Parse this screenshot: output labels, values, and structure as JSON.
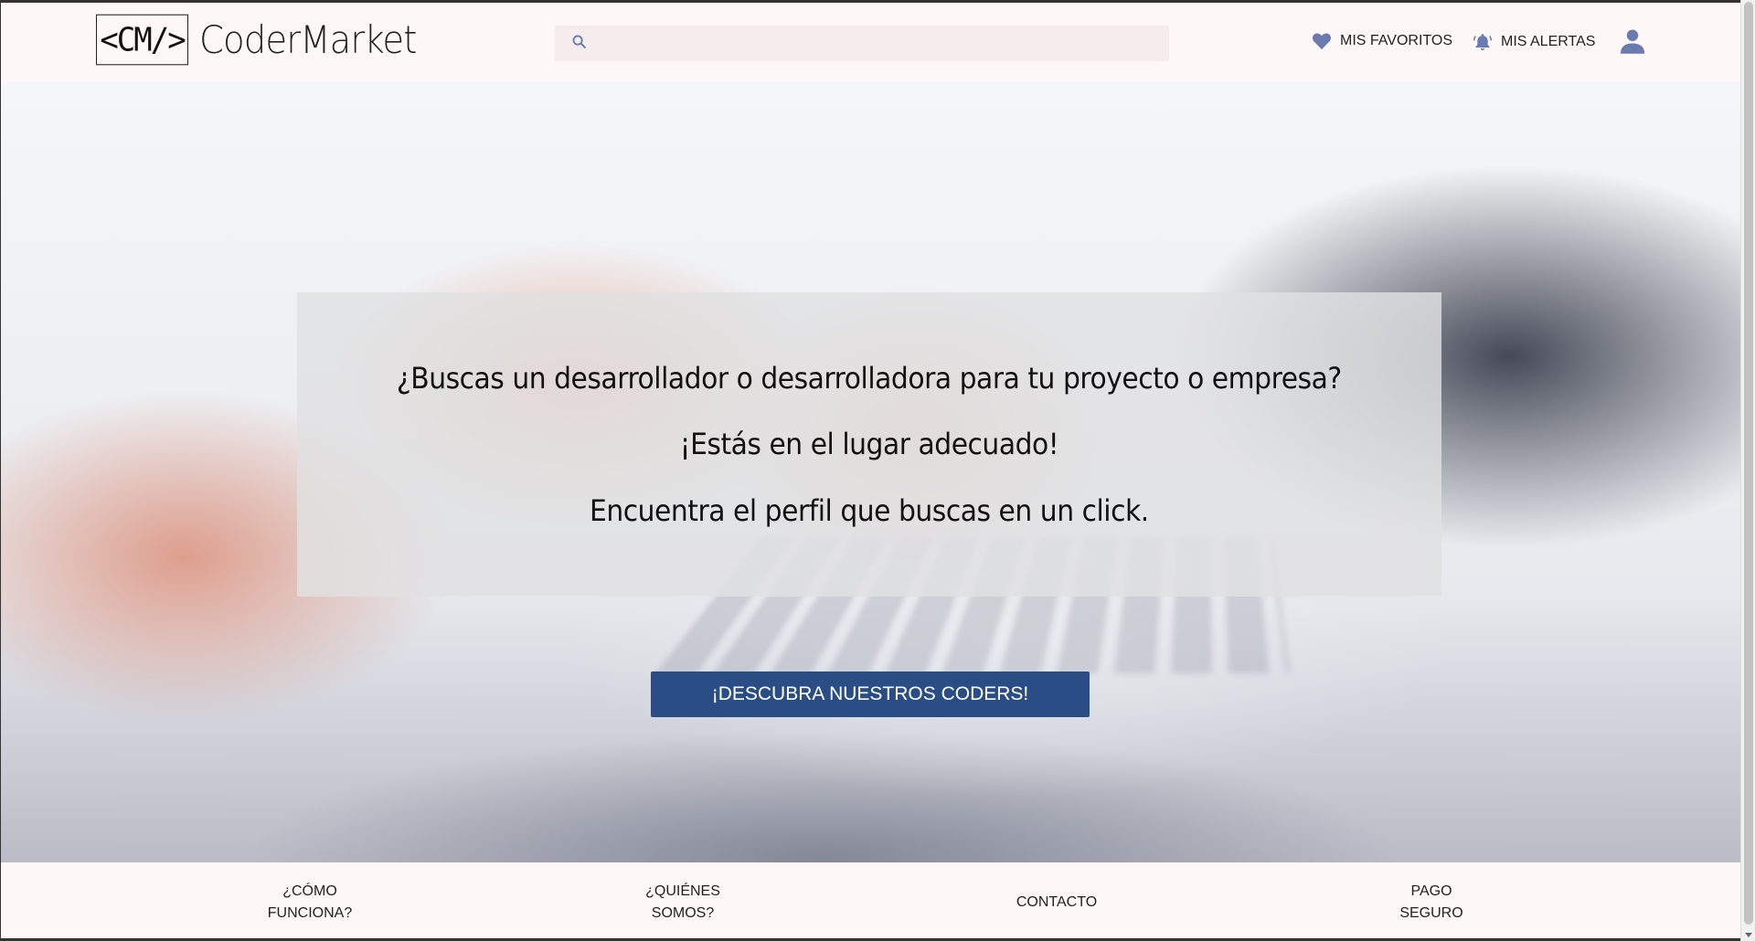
{
  "header": {
    "logo_mark": "<CM/>",
    "logo_text": "CoderMarket",
    "search_placeholder": "",
    "favorites_label": "MIS FAVORITOS",
    "alerts_label": "MIS ALERTAS"
  },
  "hero": {
    "line1": "¿Buscas un desarrollador o desarrolladora para tu proyecto o empresa?",
    "line2": "¡Estás en el lugar adecuado!",
    "line3": "Encuentra el perfil que buscas en un click.",
    "cta_label": "¡DESCUBRA NUESTROS CODERS!"
  },
  "footer": {
    "links": [
      "¿CÓMO\nFUNCIONA?",
      "¿QUIÉNES\nSOMOS?",
      "CONTACTO",
      "PAGO\nSEGURO"
    ]
  },
  "colors": {
    "accent": "#2a4d86",
    "icon": "#6b7bb0",
    "background": "#fdf8f7",
    "search_bg": "#f4eced"
  },
  "icons": [
    "search-icon",
    "heart-icon",
    "bell-icon",
    "user-icon"
  ]
}
